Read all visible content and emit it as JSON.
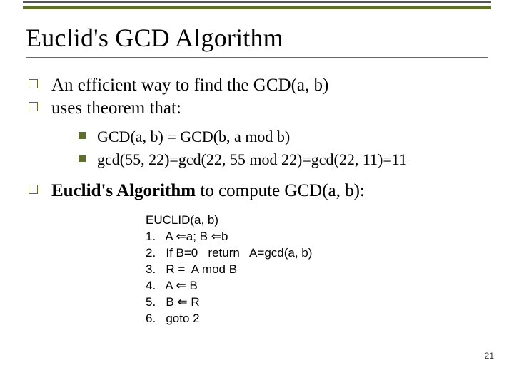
{
  "title": "Euclid's GCD Algorithm",
  "bullet1": "An efficient way to find the GCD(a, b)",
  "bullet2": "uses theorem that:",
  "sub1": "GCD(a, b) = GCD(b, a mod b)",
  "sub2": "gcd(55, 22)=gcd(22, 55 mod 22)=gcd(22, 11)=11",
  "bullet3_bold": "Euclid's Algorithm",
  "bullet3_rest": " to compute GCD(a, b):",
  "pseudo": {
    "header": "EUCLID(a, b)",
    "s1": "1.   A ⇐a; B ⇐b",
    "s2": "2.   If B=0   return   A=gcd(a, b)",
    "s3": "3.   R =  A mod B",
    "s4": "4.   A ⇐ B",
    "s5": "5.   B ⇐ R",
    "s6": "6.   goto 2"
  },
  "pagenum": "21"
}
